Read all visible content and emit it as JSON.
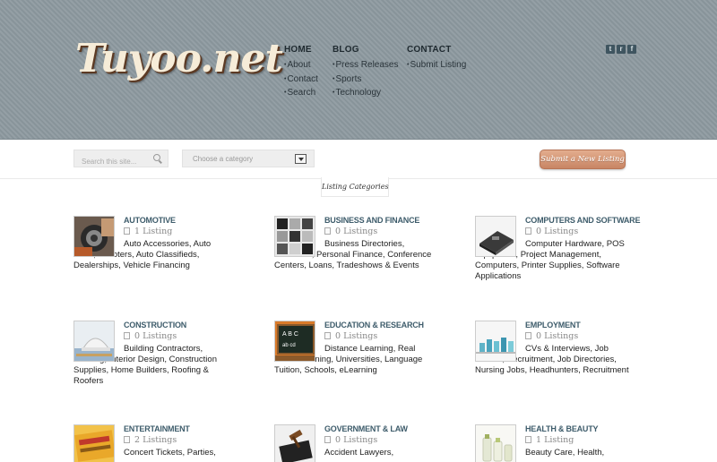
{
  "site": {
    "logo_text": "Tuyoo.net",
    "colors": {
      "header_bg": "#8e9aa0",
      "accent": "#3e5c6b",
      "button": "#d69a78"
    }
  },
  "nav": {
    "home": {
      "title": "HOME",
      "items": [
        "About",
        "Contact",
        "Search"
      ]
    },
    "blog": {
      "title": "BLOG",
      "items": [
        "Press Releases",
        "Sports",
        "Technology"
      ]
    },
    "contact": {
      "title": "CONTACT",
      "items": [
        "Submit Listing"
      ]
    }
  },
  "social": [
    {
      "icon": "twitter-icon",
      "glyph": "t"
    },
    {
      "icon": "rss-icon",
      "glyph": "r"
    },
    {
      "icon": "facebook-icon",
      "glyph": "f"
    }
  ],
  "toolbar": {
    "search_placeholder": "Search this site...",
    "category_select": "Choose a category",
    "submit_label": "Submit a New Listing"
  },
  "section_tab": "Listing Categories",
  "categories": [
    {
      "title": "AUTOMOTIVE",
      "count": "1 Listing",
      "desc": "Auto Accessories, Auto Parts, Scooters, Auto Classifieds, Dealerships, Vehicle Financing"
    },
    {
      "title": "BUSINESS AND FINANCE",
      "count": "0 Listings",
      "desc": "Business Directories, Insurance, Personal Finance, Conference Centers, Loans, Tradeshows & Events"
    },
    {
      "title": "COMPUTERS AND SOFTWARE",
      "count": "0 Listings",
      "desc": "Computer Hardware, POS Equipment, Project Management, Computers, Printer Supplies, Software Applications"
    },
    {
      "title": "CONSTRUCTION",
      "count": "0 Listings",
      "desc": "Building Contractors, Flooring, Interior Design, Construction Supplies, Home Builders, Roofing & Roofers"
    },
    {
      "title": "EDUCATION & RESEARCH",
      "count": "0 Listings",
      "desc": "Distance Learning, Real Estate Training, Universities, Language Tuition, Schools, eLearning"
    },
    {
      "title": "EMPLOYMENT",
      "count": "0 Listings",
      "desc": "CVs & Interviews, Job Search, Recruitment, Job Directories, Nursing Jobs, Headhunters, Recruitment"
    },
    {
      "title": "ENTERTAINMENT",
      "count": "2 Listings",
      "desc": "Concert Tickets, Parties,"
    },
    {
      "title": "GOVERNMENT & LAW",
      "count": "0 Listings",
      "desc": "Accident Lawyers,"
    },
    {
      "title": "HEALTH & BEAUTY",
      "count": "1 Listing",
      "desc": "Beauty Care, Health,"
    }
  ]
}
